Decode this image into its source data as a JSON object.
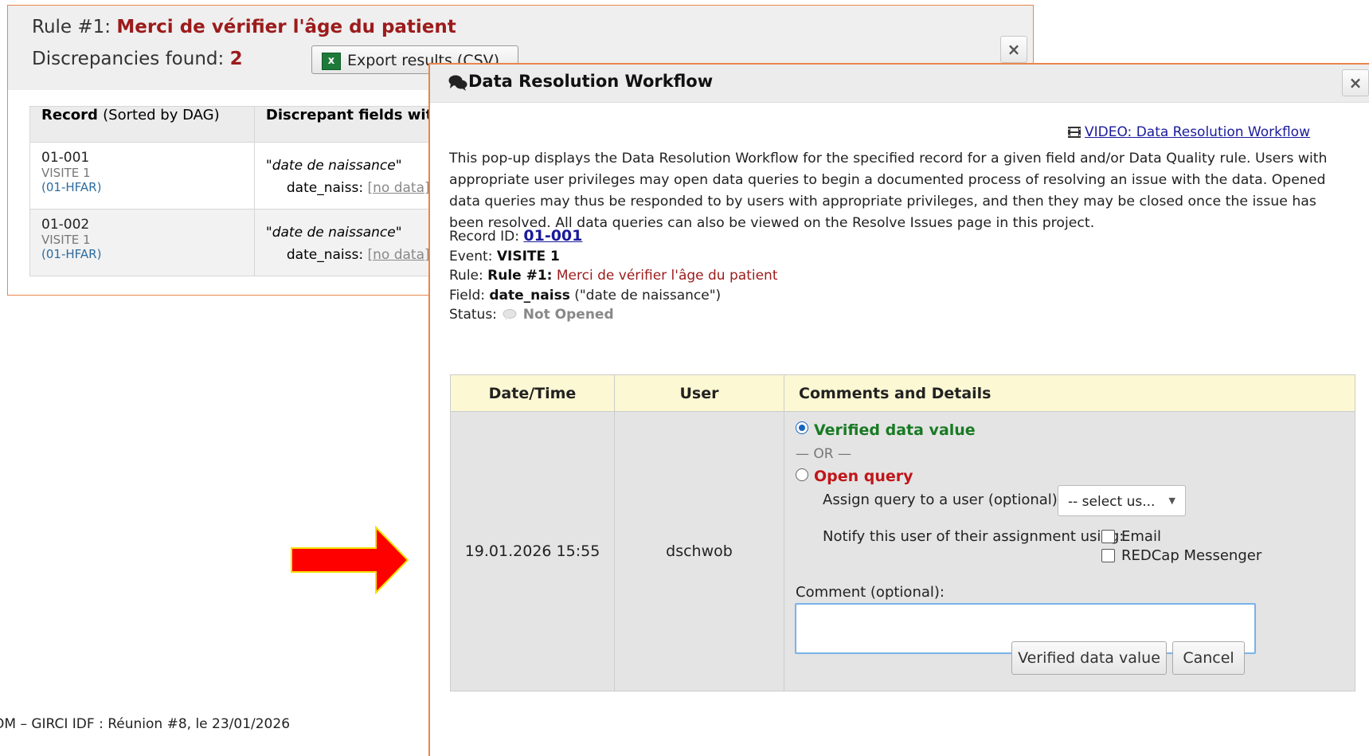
{
  "rule_dialog": {
    "rule_prefix": "Rule #1:",
    "rule_name": "Merci de vérifier l'âge du patient",
    "discrepancies_label": "Discrepancies found:",
    "discrepancies_count": "2",
    "export_button": "Export results (CSV)",
    "close_icon": "×",
    "table": {
      "headers": [
        {
          "label": "Record",
          "sub": "(Sorted by DAG)"
        },
        {
          "label": "Discrepant fields with"
        }
      ],
      "rows": [
        {
          "record": "01-001",
          "event": "VISITE 1",
          "dag": "(01-HFAR)",
          "field_label": "\"date de naissance\"",
          "field_name": "date_naiss:",
          "field_value": "[no data]"
        },
        {
          "record": "01-002",
          "event": "VISITE 1",
          "dag": "(01-HFAR)",
          "field_label": "\"date de naissance\"",
          "field_name": "date_naiss:",
          "field_value": "[no data]"
        }
      ]
    }
  },
  "footer_text": "OM – GIRCI IDF : Réunion #8, le 23/01/2026",
  "drw": {
    "title": "Data Resolution Workflow",
    "close_icon": "×",
    "video_link": "VIDEO: Data Resolution Workflow",
    "intro": "This pop-up displays the Data Resolution Workflow for the specified record for a given field and/or Data Quality rule. Users with appropriate user privileges may open data queries to begin a documented process of resolving an issue with the data. Opened data queries may thus be responded to by users with appropriate privileges, and then they may be closed once the issue has been resolved. All data queries can also be viewed on the Resolve Issues page in this project.",
    "record_label": "Record ID:",
    "record_value": "01-001",
    "event_label": "Event:",
    "event_value": "VISITE 1",
    "rule_label": "Rule:",
    "rule_strong": "Rule #1:",
    "rule_value": "Merci de vérifier l'âge du patient",
    "field_label": "Field:",
    "field_strong": "date_naiss",
    "field_value": "(\"date de naissance\")",
    "status_label": "Status:",
    "status_value": "Not Opened",
    "history": {
      "headers": [
        "Date/Time",
        "User",
        "Comments and Details"
      ],
      "datetime": "19.01.2026 15:55",
      "user": "dschwob",
      "verified_option": "Verified data value",
      "verified_checked": true,
      "or_text": "— OR —",
      "open_option": "Open query",
      "assign_label": "Assign query to a user (optional):",
      "assign_select": "-- select us...",
      "notify_label": "Notify this user of their assignment using:",
      "notify_email": "Email",
      "notify_messenger": "REDCap Messenger",
      "comment_label": "Comment (optional):",
      "comment_value": ""
    },
    "buttons": {
      "verify": "Verified data value",
      "cancel": "Cancel"
    }
  },
  "colors": {
    "dialog_border": "#e8874b",
    "rule_red": "#9c1b1b",
    "verified_green": "#197a24",
    "open_red": "#c0161a",
    "header_yellow": "#fcf8d3",
    "arrow_red": "#ff0000"
  },
  "icons": {
    "export": "excel-icon",
    "title": "comments-icon",
    "video": "film-icon",
    "status": "speech-bubble-icon",
    "annotation": "arrow-right-icon"
  }
}
